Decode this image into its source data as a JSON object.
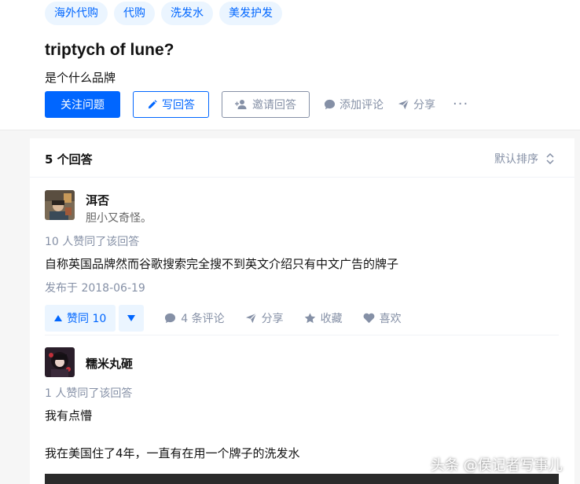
{
  "question": {
    "topics": [
      "海外代购",
      "代购",
      "洗发水",
      "美发护发"
    ],
    "title": "triptych of lune?",
    "detail": "是个什么品牌",
    "actions": {
      "follow": "关注问题",
      "write_answer": "写回答",
      "invite": "邀请回答",
      "add_comment": "添加评论",
      "share": "分享",
      "more": "···"
    }
  },
  "answer_list": {
    "count": "5 个回答",
    "sort": "默认排序"
  },
  "answers": [
    {
      "author_name": "洱否",
      "author_bio": "胆小又奇怪。",
      "votes_text": "10 人赞同了该回答",
      "content": "自称英国品牌然而谷歌搜索完全搜不到英文介绍只有中文广告的牌子",
      "pub_date": "发布于 2018-06-19",
      "vote_label": "赞同 10",
      "comments": "4 条评论",
      "share": "分享",
      "collect": "收藏",
      "like": "喜欢"
    },
    {
      "author_name": "糯米丸砸",
      "votes_text": "1 人赞同了该回答",
      "content_line1": "我有点懵",
      "content_line2": "我在美国住了4年，一直有在用一个牌子的洗发水"
    }
  ],
  "watermark": "头条 @侯记者写事儿",
  "colors": {
    "accent": "#0066ff",
    "muted": "#8590a6",
    "tag_bg": "#ebf5ff"
  }
}
